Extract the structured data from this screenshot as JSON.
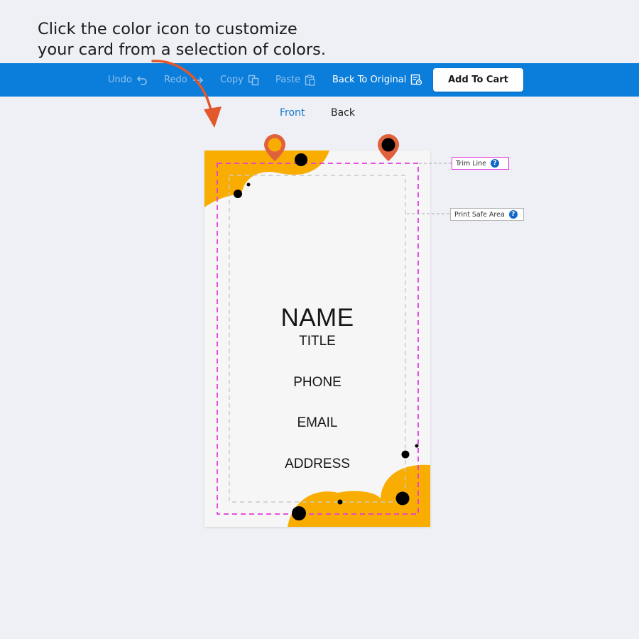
{
  "instruction": {
    "line1": "Click the color icon to customize",
    "line2": "your card from a selection of colors."
  },
  "toolbar": {
    "undo": "Undo",
    "redo": "Redo",
    "copy": "Copy",
    "paste": "Paste",
    "back_to_original": "Back To Original",
    "add_to_cart": "Add To Cart"
  },
  "sides": {
    "front": "Front",
    "back": "Back",
    "active": "front"
  },
  "card": {
    "name": "NAME",
    "title": "TITLE",
    "phone": "PHONE",
    "email": "EMAIL",
    "address": "ADDRESS"
  },
  "guides": {
    "trim_line": "Trim Line",
    "print_safe_area": "Print Safe Area",
    "help_symbol": "?"
  },
  "color_pins": [
    {
      "name": "pin-color-orange",
      "color": "#f9ad00"
    },
    {
      "name": "pin-color-black",
      "color": "#000000"
    }
  ],
  "colors": {
    "toolbar_blue": "#0b7dda",
    "accent_orange": "#f9ad00",
    "pin_red": "#e0623d",
    "trim_magenta": "#e23be0",
    "arrow_orange": "#e2572b"
  },
  "icons": {
    "undo": "undo-icon",
    "redo": "redo-icon",
    "copy": "copy-icon",
    "paste": "paste-icon",
    "back_to_original": "reset-icon",
    "help": "help-icon"
  }
}
